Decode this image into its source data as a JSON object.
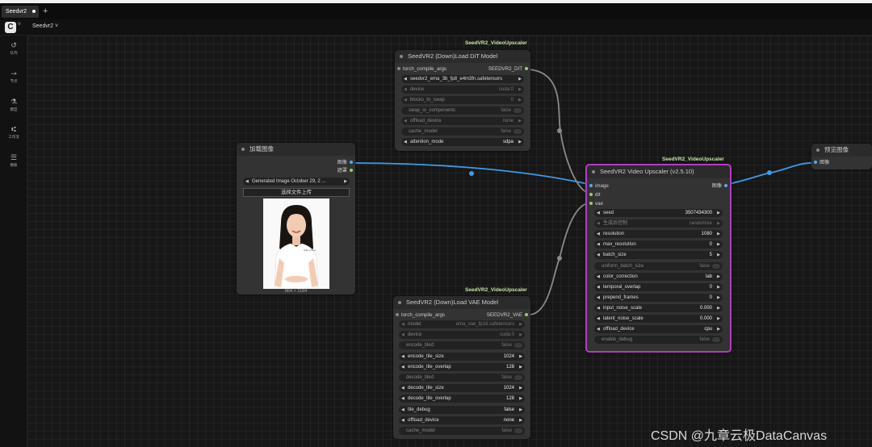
{
  "tab": {
    "label": "Seedvr2"
  },
  "toolbar": {
    "workflow_name": "Seedvr2 ˅"
  },
  "sidebar": {
    "items": [
      {
        "label": "队列",
        "icon": "history-icon",
        "glyph": "↺"
      },
      {
        "label": "节点",
        "icon": "node-library-icon",
        "glyph": "⊸"
      },
      {
        "label": "模型",
        "icon": "model-library-icon",
        "glyph": "⚗"
      },
      {
        "label": "工作流",
        "icon": "workflow-icon",
        "glyph": "⑆"
      },
      {
        "label": "模板",
        "icon": "templates-icon",
        "glyph": "☰"
      }
    ]
  },
  "colors": {
    "accent_selected": "#b33cc4",
    "image_link": "#3d9be9",
    "model_link": "#8a8a8a",
    "vae_link": "#8a8a8a",
    "badge": "#c9e6a8",
    "port_green": "#8fd36b",
    "port_blue": "#58a8f5"
  },
  "nodes": {
    "dit": {
      "badge": "SeedVR2_VideoUpscaler",
      "title": "SeedVR2 (Down)Load DiT Model",
      "input": "torch_compile_args",
      "output": "SEEDVR2_DIT",
      "widgets": [
        {
          "name": "seedvr2_ema_3b_fp8_e4m3fn.safetensors",
          "value": "",
          "type": "combo"
        },
        {
          "name": "device",
          "value": "cuda:0",
          "type": "combo"
        },
        {
          "name": "blocks_to_swap",
          "value": "0",
          "type": "number"
        },
        {
          "name": "swap_io_components",
          "value": "false",
          "type": "toggle"
        },
        {
          "name": "offload_device",
          "value": "none",
          "type": "combo"
        },
        {
          "name": "cache_model",
          "value": "false",
          "type": "toggle"
        },
        {
          "name": "attention_mode",
          "value": "sdpa",
          "type": "combo"
        }
      ]
    },
    "load_image": {
      "title": "加载图像",
      "outputs": [
        "图像",
        "遮罩"
      ],
      "file": "Generated Image October 29, 2 ...",
      "upload_label": "选择文件上传",
      "image_size": "864 × 1184",
      "brand_text": "Seller Culture"
    },
    "vae": {
      "badge": "SeedVR2_VideoUpscaler",
      "title": "SeedVR2 (Down)Load VAE Model",
      "input": "torch_compile_args",
      "output": "SEEDVR2_VAE",
      "widgets": [
        {
          "name": "model",
          "value": "ema_vae_fp16.safetensors",
          "type": "combo"
        },
        {
          "name": "device",
          "value": "cuda:0",
          "type": "combo"
        },
        {
          "name": "encode_tiled",
          "value": "false",
          "type": "toggle"
        },
        {
          "name": "encode_tile_size",
          "value": "1024",
          "type": "number"
        },
        {
          "name": "encode_tile_overlap",
          "value": "128",
          "type": "number"
        },
        {
          "name": "decode_tiled",
          "value": "false",
          "type": "toggle"
        },
        {
          "name": "decode_tile_size",
          "value": "1024",
          "type": "number"
        },
        {
          "name": "decode_tile_overlap",
          "value": "128",
          "type": "number"
        },
        {
          "name": "tile_debug",
          "value": "false",
          "type": "combo"
        },
        {
          "name": "offload_device",
          "value": "none",
          "type": "combo"
        },
        {
          "name": "cache_model",
          "value": "false",
          "type": "toggle"
        }
      ]
    },
    "upscaler": {
      "badge": "SeedVR2_VideoUpscaler",
      "title": "SeedVR2 Video Upscaler (v2.5.10)",
      "inputs": [
        "image",
        "dit",
        "vae"
      ],
      "output": "图像",
      "widgets": [
        {
          "name": "seed",
          "value": "3507434300",
          "type": "number"
        },
        {
          "name": "生成后控制",
          "value": "randomize",
          "type": "combo"
        },
        {
          "name": "resolution",
          "value": "1080",
          "type": "number"
        },
        {
          "name": "max_resolution",
          "value": "0",
          "type": "number"
        },
        {
          "name": "batch_size",
          "value": "5",
          "type": "number"
        },
        {
          "name": "uniform_batch_size",
          "value": "false",
          "type": "toggle"
        },
        {
          "name": "color_correction",
          "value": "lab",
          "type": "combo"
        },
        {
          "name": "temporal_overlap",
          "value": "0",
          "type": "number"
        },
        {
          "name": "prepend_frames",
          "value": "0",
          "type": "number"
        },
        {
          "name": "input_noise_scale",
          "value": "0.000",
          "type": "number"
        },
        {
          "name": "latent_noise_scale",
          "value": "0.000",
          "type": "number"
        },
        {
          "name": "offload_device",
          "value": "cpu",
          "type": "combo"
        },
        {
          "name": "enable_debug",
          "value": "false",
          "type": "toggle"
        }
      ]
    },
    "preview": {
      "title": "预览图像",
      "input": "图像"
    }
  },
  "watermark": "CSDN @九章云极DataCanvas"
}
